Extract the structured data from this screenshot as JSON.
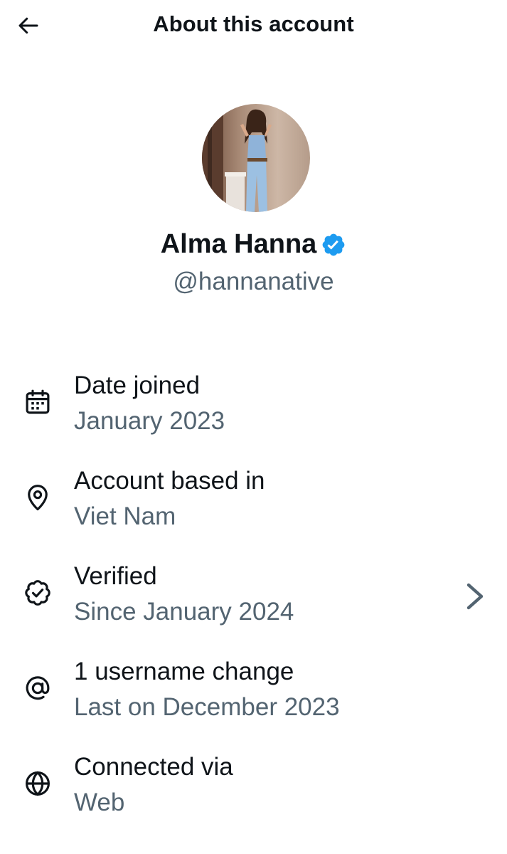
{
  "header": {
    "title": "About this account",
    "back_icon": "arrow-left-icon"
  },
  "profile": {
    "display_name": "Alma Hanna",
    "handle": "@hannanative",
    "verified_color": "#1d9bf0"
  },
  "info_items": [
    {
      "icon": "calendar-icon",
      "title": "Date joined",
      "subtitle": "January 2023"
    },
    {
      "icon": "location-pin-icon",
      "title": "Account based in",
      "subtitle": "Viet Nam"
    },
    {
      "icon": "verified-badge-outline-icon",
      "title": "Verified",
      "subtitle": "Since January 2024",
      "has_chevron": true
    },
    {
      "icon": "at-sign-icon",
      "title": "1 username change",
      "subtitle": "Last on December 2023"
    },
    {
      "icon": "globe-icon",
      "title": "Connected via",
      "subtitle": "Web"
    }
  ],
  "colors": {
    "primary_text": "#0f1419",
    "secondary_text": "#536471",
    "accent": "#1d9bf0"
  }
}
